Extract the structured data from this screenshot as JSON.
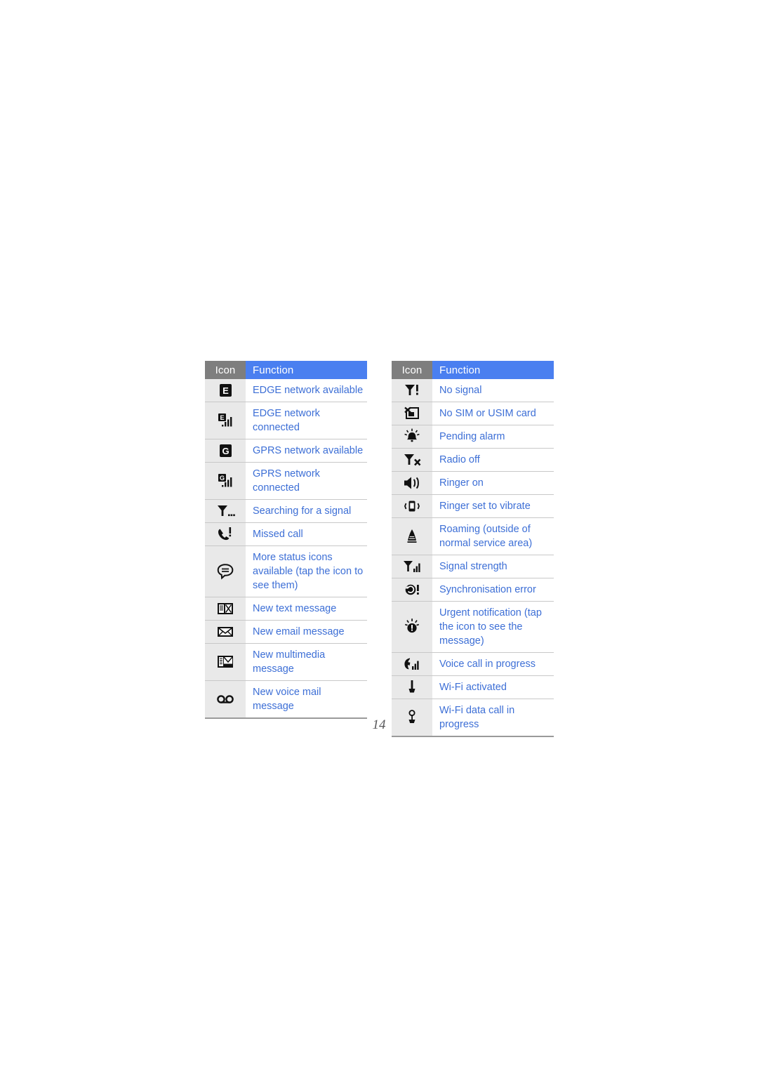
{
  "page": {
    "number": "14"
  },
  "tables": [
    {
      "id": "status-icons-table-left",
      "headers": {
        "icon": "Icon",
        "function": "Function"
      },
      "rows": [
        {
          "icon_name": "edge-available-icon",
          "function": "EDGE network available"
        },
        {
          "icon_name": "edge-connected-icon",
          "function": "EDGE network connected"
        },
        {
          "icon_name": "gprs-available-icon",
          "function": "GPRS network available"
        },
        {
          "icon_name": "gprs-connected-icon",
          "function": "GPRS network connected"
        },
        {
          "icon_name": "searching-signal-icon",
          "function": "Searching for a signal"
        },
        {
          "icon_name": "missed-call-icon",
          "function": "Missed call"
        },
        {
          "icon_name": "more-status-icons-icon",
          "function": "More status icons available (tap the icon to see them)"
        },
        {
          "icon_name": "new-text-message-icon",
          "function": "New text message"
        },
        {
          "icon_name": "new-email-message-icon",
          "function": "New email message"
        },
        {
          "icon_name": "new-multimedia-message-icon",
          "function": "New multimedia message"
        },
        {
          "icon_name": "new-voice-mail-icon",
          "function": "New voice mail message"
        }
      ]
    },
    {
      "id": "status-icons-table-right",
      "headers": {
        "icon": "Icon",
        "function": "Function"
      },
      "rows": [
        {
          "icon_name": "no-signal-icon",
          "function": "No signal"
        },
        {
          "icon_name": "no-sim-card-icon",
          "function": "No SIM or USIM card"
        },
        {
          "icon_name": "pending-alarm-icon",
          "function": "Pending alarm"
        },
        {
          "icon_name": "radio-off-icon",
          "function": "Radio off"
        },
        {
          "icon_name": "ringer-on-icon",
          "function": "Ringer on"
        },
        {
          "icon_name": "ringer-vibrate-icon",
          "function": "Ringer set to vibrate"
        },
        {
          "icon_name": "roaming-icon",
          "function": "Roaming (outside of normal service area)"
        },
        {
          "icon_name": "signal-strength-icon",
          "function": "Signal strength"
        },
        {
          "icon_name": "synchronisation-error-icon",
          "function": "Synchronisation error"
        },
        {
          "icon_name": "urgent-notification-icon",
          "function": "Urgent notification (tap the icon to see the message)"
        },
        {
          "icon_name": "voice-call-in-progress-icon",
          "function": "Voice call in progress"
        },
        {
          "icon_name": "wifi-activated-icon",
          "function": "Wi-Fi activated"
        },
        {
          "icon_name": "wifi-data-call-icon",
          "function": "Wi-Fi data call in progress"
        }
      ]
    }
  ],
  "colors": {
    "header_icon_bg": "#7e7e7e",
    "header_function_bg": "#4a7ff0",
    "header_text": "#ffffff",
    "icon_cell_bg": "#e9e9e9",
    "function_text": "#3d6fd6",
    "row_divider": "#c8c8c8",
    "page_number_text": "#58585a"
  }
}
